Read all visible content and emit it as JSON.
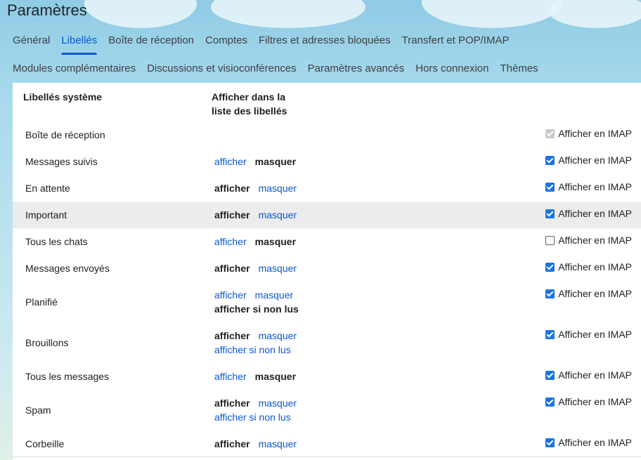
{
  "page_title": "Paramètres",
  "tabs_row1": [
    {
      "label": "Général",
      "active": false
    },
    {
      "label": "Libellés",
      "active": true
    },
    {
      "label": "Boîte de réception",
      "active": false
    },
    {
      "label": "Comptes",
      "active": false
    },
    {
      "label": "Filtres et adresses bloquées",
      "active": false
    },
    {
      "label": "Transfert et POP/IMAP",
      "active": false
    }
  ],
  "tabs_row2": [
    {
      "label": "Modules complémentaires",
      "active": false
    },
    {
      "label": "Discussions et visioconférences",
      "active": false
    },
    {
      "label": "Paramètres avancés",
      "active": false
    },
    {
      "label": "Hors connexion",
      "active": false
    },
    {
      "label": "Thèmes",
      "active": false
    }
  ],
  "section": {
    "col1_header": "Libellés système",
    "col2_header_line1": "Afficher dans la",
    "col2_header_line2": "liste des libellés"
  },
  "imap_label": "Afficher en IMAP",
  "link_text": {
    "show": "afficher",
    "hide": "masquer",
    "show_unread": "afficher si non lus"
  },
  "colors": {
    "link": "#0b57d0",
    "active_tab": "#0b57d0",
    "checkbox": "#1a73e8",
    "row_highlight": "#ececec"
  },
  "labels": [
    {
      "name": "Boîte de réception",
      "options": [],
      "imap": true,
      "imap_disabled": true,
      "highlight": false
    },
    {
      "name": "Messages suivis",
      "options": [
        "show",
        "hide"
      ],
      "selected": "hide",
      "imap": true,
      "highlight": false
    },
    {
      "name": "En attente",
      "options": [
        "show",
        "hide"
      ],
      "selected": "show",
      "imap": true,
      "highlight": false
    },
    {
      "name": "Important",
      "options": [
        "show",
        "hide"
      ],
      "selected": "show",
      "imap": true,
      "highlight": true
    },
    {
      "name": "Tous les chats",
      "options": [
        "show",
        "hide"
      ],
      "selected": "hide",
      "imap": false,
      "highlight": false
    },
    {
      "name": "Messages envoyés",
      "options": [
        "show",
        "hide"
      ],
      "selected": "show",
      "imap": true,
      "highlight": false
    },
    {
      "name": "Planifié",
      "options": [
        "show",
        "hide",
        "show_unread"
      ],
      "selected": "show_unread",
      "imap": true,
      "highlight": false
    },
    {
      "name": "Brouillons",
      "options": [
        "show",
        "hide",
        "show_unread"
      ],
      "selected": "show",
      "imap": true,
      "highlight": false
    },
    {
      "name": "Tous les messages",
      "options": [
        "show",
        "hide"
      ],
      "selected": "hide",
      "imap": true,
      "highlight": false
    },
    {
      "name": "Spam",
      "options": [
        "show",
        "hide",
        "show_unread"
      ],
      "selected": "show",
      "imap": true,
      "highlight": false
    },
    {
      "name": "Corbeille",
      "options": [
        "show",
        "hide"
      ],
      "selected": "show",
      "imap": true,
      "highlight": false
    }
  ]
}
